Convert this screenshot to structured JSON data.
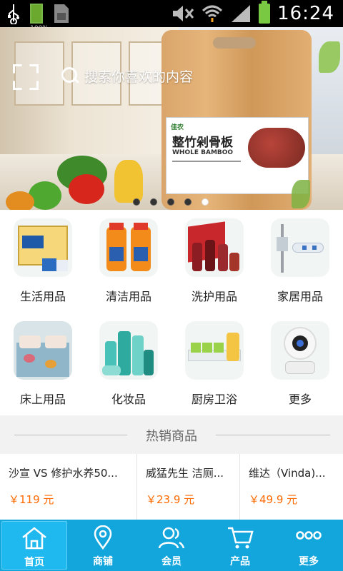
{
  "status_bar": {
    "time": "16:24",
    "battery_small_label": "100%"
  },
  "banner": {
    "search_placeholder": "搜索你喜欢的内容",
    "product_label_brand": "佳农",
    "product_label_title": "整竹剁骨板",
    "product_label_en": "WHOLE BAMBOO",
    "slides": 5,
    "active_slide": 5
  },
  "categories": [
    {
      "label": "生活用品",
      "icon": "tissue-pack-icon"
    },
    {
      "label": "清洁用品",
      "icon": "cleaner-bottles-icon"
    },
    {
      "label": "洗护用品",
      "icon": "haircare-set-icon"
    },
    {
      "label": "家居用品",
      "icon": "mop-rack-icon"
    },
    {
      "label": "床上用品",
      "icon": "bedding-icon"
    },
    {
      "label": "化妆品",
      "icon": "cosmetics-icon"
    },
    {
      "label": "厨房卫浴",
      "icon": "spice-jars-icon"
    },
    {
      "label": "更多",
      "icon": "camera-icon"
    }
  ],
  "hot_section": {
    "title": "热销商品"
  },
  "products": [
    {
      "name": "沙宣 VS 修护水养50...",
      "price": "￥119 元"
    },
    {
      "name": "威猛先生 洁厕...",
      "price": "￥23.9 元"
    },
    {
      "name": "维达（Vinda)...",
      "price": "￥49.9 元"
    }
  ],
  "bottom_nav": [
    {
      "label": "首页",
      "icon": "home-icon",
      "active": true
    },
    {
      "label": "商铺",
      "icon": "location-pin-icon",
      "active": false
    },
    {
      "label": "会员",
      "icon": "members-icon",
      "active": false
    },
    {
      "label": "产品",
      "icon": "cart-icon",
      "active": false
    },
    {
      "label": "更多",
      "icon": "more-dots-icon",
      "active": false
    }
  ],
  "colors": {
    "nav_bg": "#13a6dd",
    "price": "#ff6a00"
  }
}
